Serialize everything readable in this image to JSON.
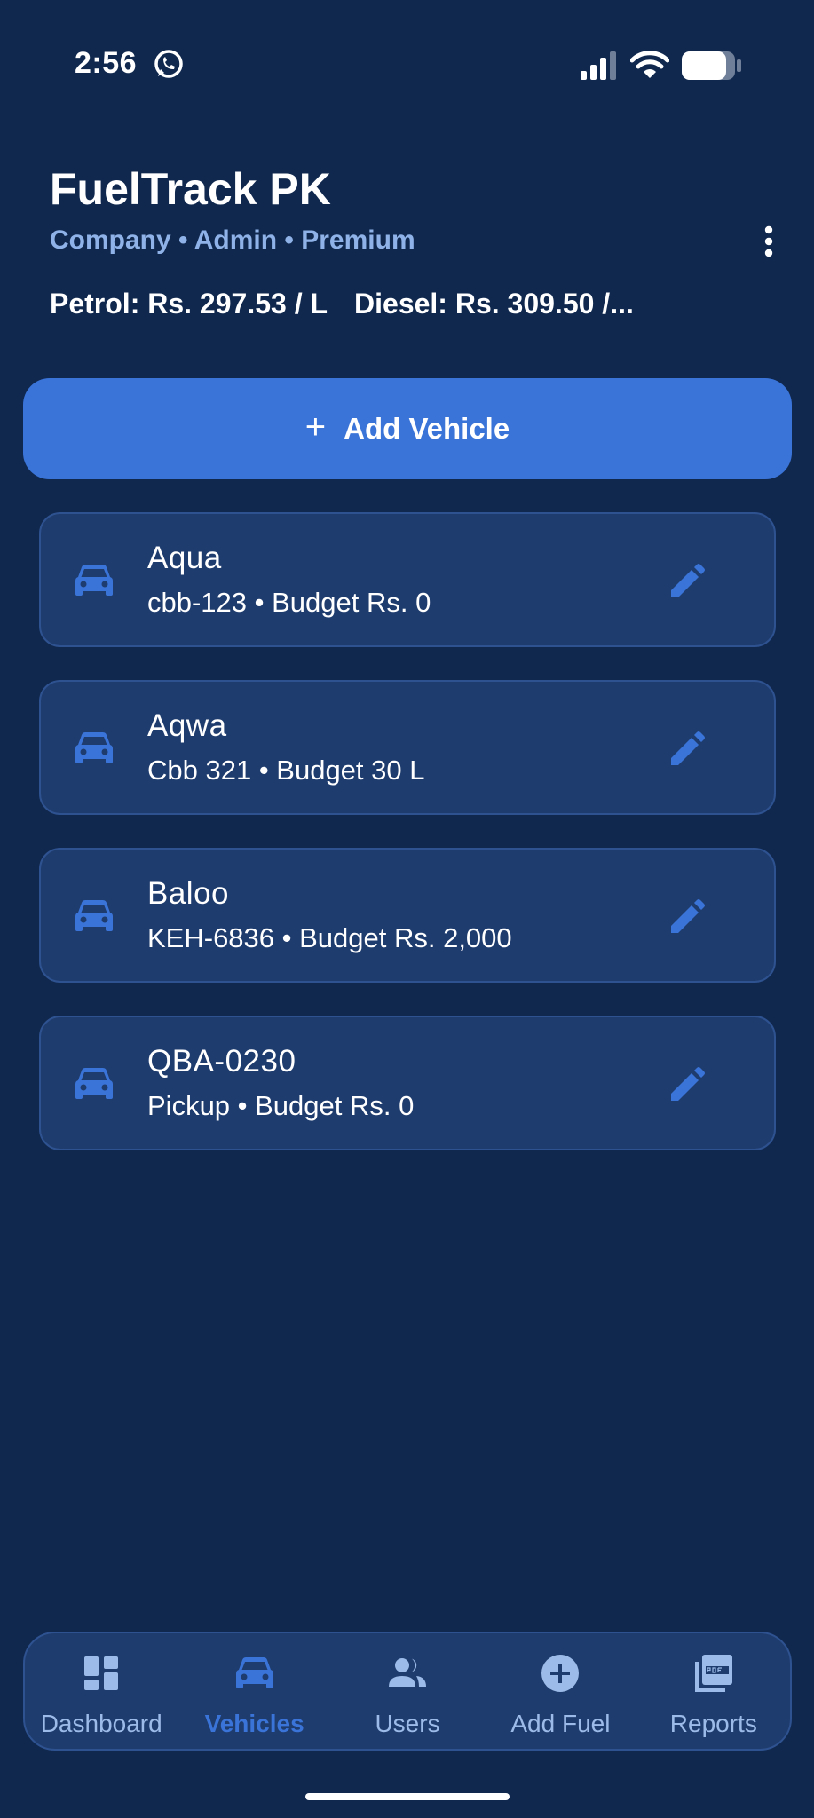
{
  "status_bar": {
    "time": "2:56"
  },
  "header": {
    "title": "FuelTrack PK",
    "subtitle": "Company • Admin • Premium",
    "petrol_price": "Petrol: Rs. 297.53 / L",
    "diesel_price": "Diesel: Rs. 309.50 /..."
  },
  "actions": {
    "add_vehicle_plus": "+",
    "add_vehicle_label": "Add Vehicle"
  },
  "vehicles": [
    {
      "name": "Aqua",
      "detail": "cbb-123 • Budget Rs. 0",
      "icon": "car-icon",
      "action_icon": "edit-icon"
    },
    {
      "name": "Aqwa",
      "detail": "Cbb 321 • Budget 30 L",
      "icon": "car-icon",
      "action_icon": "edit-icon"
    },
    {
      "name": "Baloo",
      "detail": "KEH-6836 • Budget Rs. 2,000",
      "icon": "car-icon",
      "action_icon": "edit-icon"
    },
    {
      "name": "QBA-0230",
      "detail": "Pickup • Budget Rs. 0",
      "icon": "car-icon",
      "action_icon": "edit-icon"
    }
  ],
  "bottom_nav": {
    "items": [
      {
        "label": "Dashboard",
        "icon": "dashboard-icon",
        "active": false
      },
      {
        "label": "Vehicles",
        "icon": "car-icon",
        "active": true
      },
      {
        "label": "Users",
        "icon": "users-icon",
        "active": false
      },
      {
        "label": "Add Fuel",
        "icon": "add-circle-icon",
        "active": false
      },
      {
        "label": "Reports",
        "icon": "pdf-icon",
        "active": false
      }
    ]
  },
  "colors": {
    "background": "#10284e",
    "card": "#1f3c6e",
    "accent": "#3a74d9",
    "subtitle": "#8fb3e8",
    "nav_inactive": "#9dbbe8"
  }
}
